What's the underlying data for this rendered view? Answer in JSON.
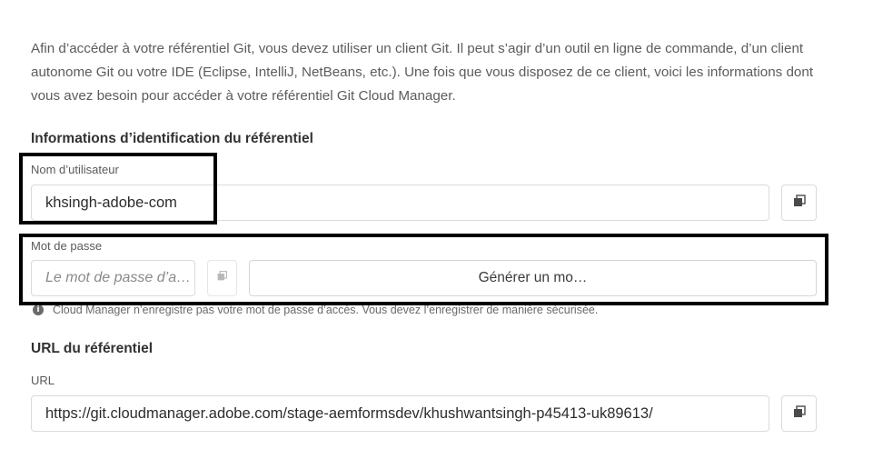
{
  "intro_text": "Afin d’accéder à votre référentiel Git, vous devez utiliser un client Git. Il peut s’agir d’un outil en ligne de commande, d’un client autonome Git ou votre IDE (Eclipse, IntelliJ, NetBeans, etc.). Une fois que vous disposez de ce client, voici les informations dont vous avez besoin pour accéder à votre référentiel Git Cloud Manager.",
  "credentials": {
    "title": "Informations d’identification du référentiel",
    "username": {
      "label": "Nom d’utilisateur",
      "value": "khsingh-adobe-com",
      "copy_icon": "copy-icon"
    },
    "password": {
      "label": "Mot de passe",
      "placeholder": "Le mot de passe d’a…",
      "copy_icon": "copy-icon",
      "generate_label": "Générer un mo…"
    },
    "note": "Cloud Manager n’enregistre pas votre mot de passe d’accès. Vous devez l’enregistrer de manière sécurisée.",
    "note_icon": "info-icon"
  },
  "repository": {
    "title": "URL du référentiel",
    "url_label": "URL",
    "url_value": "https://git.cloudmanager.adobe.com/stage-aemformsdev/khushwantsingh-p45413-uk89613/",
    "copy_icon": "copy-icon"
  },
  "colors": {
    "highlight": "#000000",
    "border": "#dadada",
    "muted_text": "#5c5c5c"
  }
}
